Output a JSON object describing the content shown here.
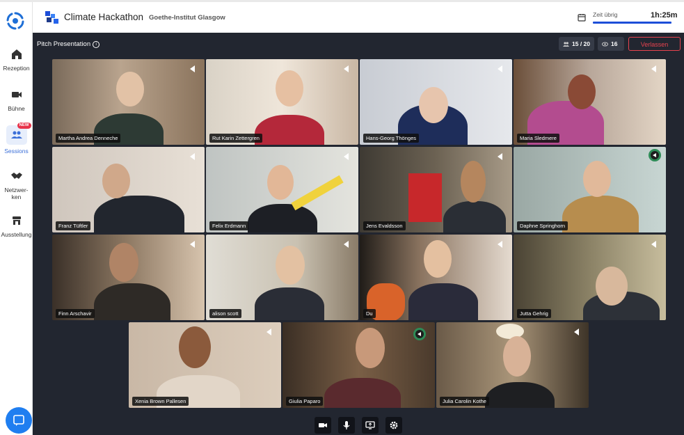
{
  "app": {
    "title": "Climate Hackathon",
    "organizer": "Goethe-Institut Glasgow"
  },
  "timer": {
    "label": "Zeit übrig",
    "value": "1h:25m"
  },
  "sidebar": {
    "items": [
      {
        "label": "Rezeption",
        "icon": "home-icon"
      },
      {
        "label": "Bühne",
        "icon": "video-camera-icon"
      },
      {
        "label": "Sessions",
        "icon": "people-icon",
        "badge": "NEW",
        "active": true
      },
      {
        "label": "Netzwer-\nken",
        "icon": "handshake-icon"
      },
      {
        "label": "Ausstellung",
        "icon": "booth-icon"
      }
    ]
  },
  "session": {
    "title": "Pitch Presentation",
    "participants": "15 / 20",
    "viewers": "16",
    "leave_label": "Verlassen"
  },
  "participants": [
    {
      "name": "Martha Andrea Denneche"
    },
    {
      "name": "Rut Karin Zettergren"
    },
    {
      "name": "Hans-Georg Thönges"
    },
    {
      "name": "Maria Sledmere"
    },
    {
      "name": "Franz Tüftler"
    },
    {
      "name": "Felix Erdmann"
    },
    {
      "name": "Jens Evaldsson"
    },
    {
      "name": "Daphne Springhorn",
      "speaking": true
    },
    {
      "name": "Finn Arschavir"
    },
    {
      "name": "alison scott"
    },
    {
      "name": "Du"
    },
    {
      "name": "Jutta Gehrig"
    },
    {
      "name": "Xenia Brown Pallesen"
    },
    {
      "name": "Giulia Paparo",
      "speaking": true
    },
    {
      "name": "Julia Carolin Kothe"
    }
  ],
  "controls": [
    "camera-icon",
    "microphone-icon",
    "screen-share-icon",
    "settings-icon"
  ],
  "colors": {
    "accent": "#1d4ed8",
    "leave": "#e8434f",
    "stage_bg": "#222630"
  }
}
